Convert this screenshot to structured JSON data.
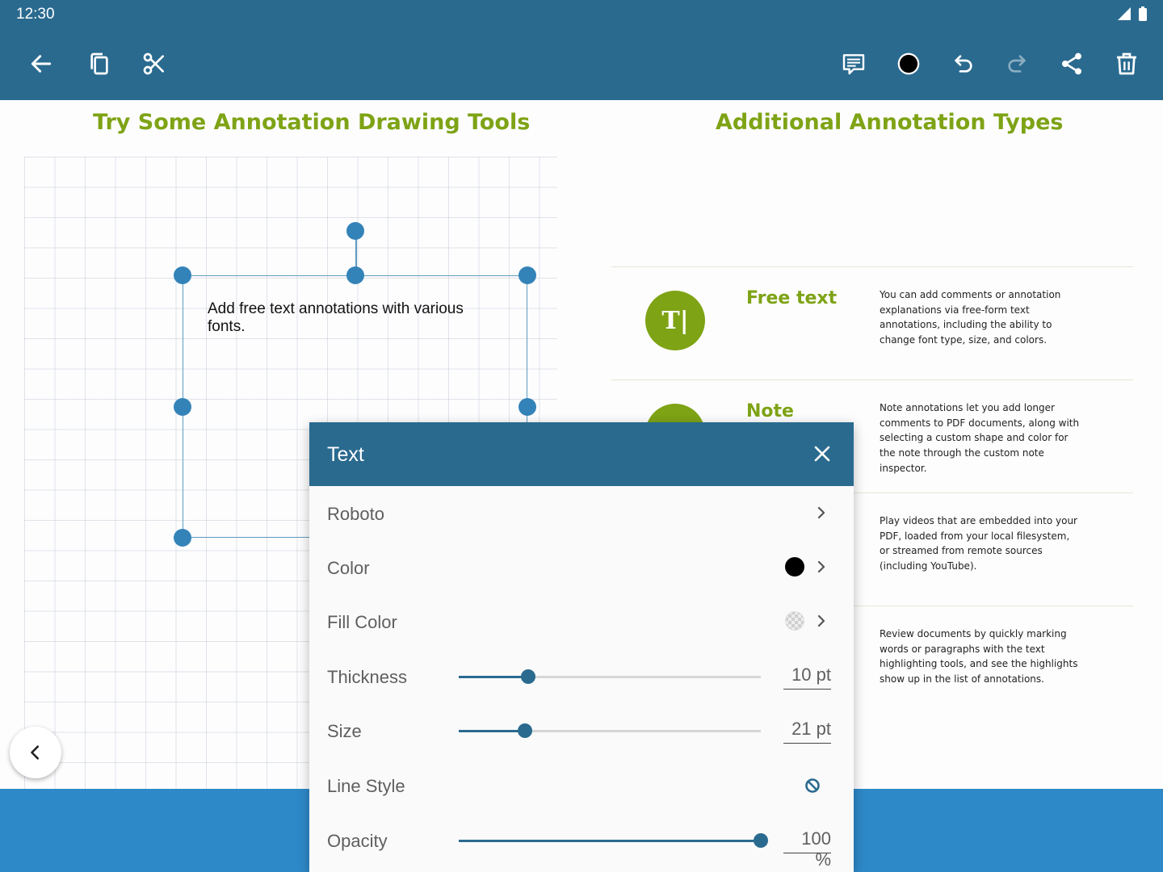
{
  "status_bar": {
    "time": "12:30"
  },
  "toolbar": {
    "left": [
      {
        "name": "back-arrow-icon"
      },
      {
        "name": "copy-icon"
      },
      {
        "name": "scissors-icon"
      }
    ],
    "right": [
      {
        "name": "comment-icon"
      },
      {
        "name": "color-icon"
      },
      {
        "name": "undo-icon"
      },
      {
        "name": "redo-icon"
      },
      {
        "name": "share-icon"
      },
      {
        "name": "delete-icon"
      }
    ]
  },
  "page": {
    "left_heading": "Try Some Annotation Drawing Tools",
    "right_heading": "Additional Annotation Types",
    "annotation_text": "Add free text annotations with various fonts.",
    "features": [
      {
        "title": "Free text",
        "icon": "T|",
        "description": "You can add comments or annotation explanations via free-form text annotations, including the ability to change font type, size, and colors."
      },
      {
        "title": "Note",
        "description": "Note annotations let you add longer comments to PDF documents, along with selecting a custom shape and color for the note through the custom note inspector."
      },
      {
        "title": "",
        "description": "Play videos that are embedded into your PDF, loaded from your local filesystem, or streamed from remote sources (including YouTube)."
      },
      {
        "title": "",
        "description": "Review documents by quickly marking words or paragraphs with the text highlighting tools, and see the highlights show up in the list of annotations."
      }
    ]
  },
  "inspector": {
    "title": "Text",
    "font": "Roboto",
    "color_label": "Color",
    "color_value": "#000000",
    "fill_color_label": "Fill Color",
    "fill_color_value": "transparent",
    "thickness_label": "Thickness",
    "thickness_fraction": 0.23,
    "thickness_value": "10 pt",
    "size_label": "Size",
    "size_fraction": 0.22,
    "size_value": "21 pt",
    "line_style_label": "Line Style",
    "line_style_icon": "none-icon",
    "opacity_label": "Opacity",
    "opacity_fraction": 1.0,
    "opacity_value": "100 %"
  },
  "colors": {
    "app_bar": "#2a6a8f",
    "accent_green": "#7ea315",
    "bottom_band": "#2e89c8"
  }
}
